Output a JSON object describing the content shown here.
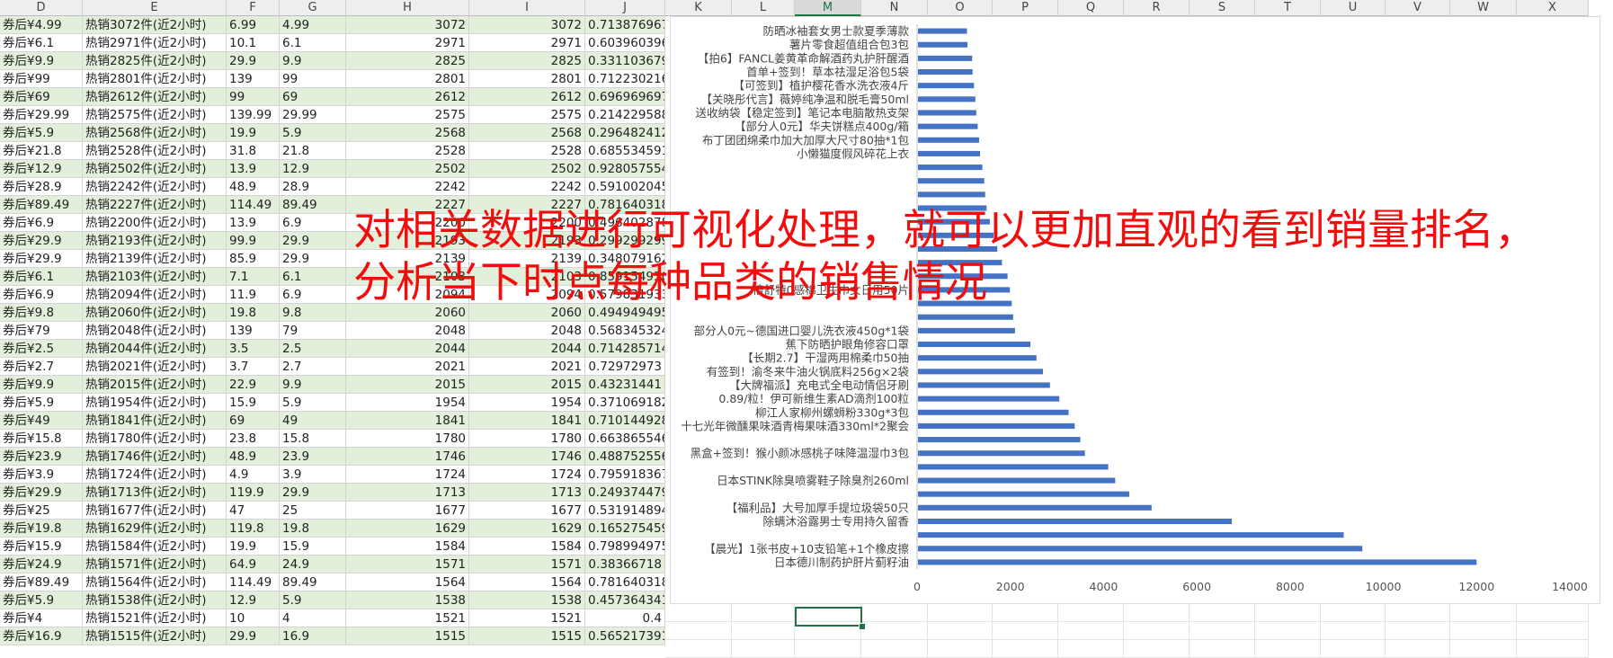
{
  "columns": [
    "D",
    "E",
    "F",
    "G",
    "H",
    "I",
    "J",
    "K",
    "L",
    "M",
    "N",
    "O",
    "P",
    "Q",
    "R",
    "S",
    "T",
    "U",
    "V",
    "W",
    "X"
  ],
  "selected_column": "M",
  "rows": [
    [
      "券后¥4.99",
      "热销3072件(近2小时)",
      "6.99",
      "4.99",
      "3072",
      "3072",
      "0.713876967"
    ],
    [
      "券后¥6.1",
      "热销2971件(近2小时)",
      "10.1",
      "6.1",
      "2971",
      "2971",
      "0.603960396"
    ],
    [
      "券后¥9.9",
      "热销2825件(近2小时)",
      "29.9",
      "9.9",
      "2825",
      "2825",
      "0.331103679"
    ],
    [
      "券后¥99",
      "热销2801件(近2小时)",
      "139",
      "99",
      "2801",
      "2801",
      "0.712230216"
    ],
    [
      "券后¥69",
      "热销2612件(近2小时)",
      "99",
      "69",
      "2612",
      "2612",
      "0.696969697"
    ],
    [
      "券后¥29.99",
      "热销2575件(近2小时)",
      "139.99",
      "29.99",
      "2575",
      "2575",
      "0.214229588"
    ],
    [
      "券后¥5.9",
      "热销2568件(近2小时)",
      "19.9",
      "5.9",
      "2568",
      "2568",
      "0.296482412"
    ],
    [
      "券后¥21.8",
      "热销2528件(近2小时)",
      "31.8",
      "21.8",
      "2528",
      "2528",
      "0.685534591"
    ],
    [
      "券后¥12.9",
      "热销2502件(近2小时)",
      "13.9",
      "12.9",
      "2502",
      "2502",
      "0.928057554"
    ],
    [
      "券后¥28.9",
      "热销2242件(近2小时)",
      "48.9",
      "28.9",
      "2242",
      "2242",
      "0.591002045"
    ],
    [
      "券后¥89.49",
      "热销2227件(近2小时)",
      "114.49",
      "89.49",
      "2227",
      "2227",
      "0.781640318"
    ],
    [
      "券后¥6.9",
      "热销2200件(近2小时)",
      "13.9",
      "6.9",
      "2200",
      "2200",
      "0.496402878"
    ],
    [
      "券后¥29.9",
      "热销2193件(近2小时)",
      "99.9",
      "29.9",
      "2193",
      "2193",
      "0.299299299"
    ],
    [
      "券后¥29.9",
      "热销2139件(近2小时)",
      "85.9",
      "29.9",
      "2139",
      "2139",
      "0.348079162"
    ],
    [
      "券后¥6.1",
      "热销2103件(近2小时)",
      "7.1",
      "6.1",
      "2103",
      "2103",
      "0.859154930"
    ],
    [
      "券后¥6.9",
      "热销2094件(近2小时)",
      "11.9",
      "6.9",
      "2094",
      "2094",
      "0.579831933"
    ],
    [
      "券后¥9.8",
      "热销2060件(近2小时)",
      "19.8",
      "9.8",
      "2060",
      "2060",
      "0.494949495"
    ],
    [
      "券后¥79",
      "热销2048件(近2小时)",
      "139",
      "79",
      "2048",
      "2048",
      "0.568345324"
    ],
    [
      "券后¥2.5",
      "热销2044件(近2小时)",
      "3.5",
      "2.5",
      "2044",
      "2044",
      "0.714285714"
    ],
    [
      "券后¥2.7",
      "热销2021件(近2小时)",
      "3.7",
      "2.7",
      "2021",
      "2021",
      "0.72972973"
    ],
    [
      "券后¥9.9",
      "热销2015件(近2小时)",
      "22.9",
      "9.9",
      "2015",
      "2015",
      "0.43231441"
    ],
    [
      "券后¥5.9",
      "热销1954件(近2小时)",
      "15.9",
      "5.9",
      "1954",
      "1954",
      "0.371069182"
    ],
    [
      "券后¥49",
      "热销1841件(近2小时)",
      "69",
      "49",
      "1841",
      "1841",
      "0.710144928"
    ],
    [
      "券后¥15.8",
      "热销1780件(近2小时)",
      "23.8",
      "15.8",
      "1780",
      "1780",
      "0.663865546"
    ],
    [
      "券后¥23.9",
      "热销1746件(近2小时)",
      "48.9",
      "23.9",
      "1746",
      "1746",
      "0.488752556"
    ],
    [
      "券后¥3.9",
      "热销1724件(近2小时)",
      "4.9",
      "3.9",
      "1724",
      "1724",
      "0.795918367"
    ],
    [
      "券后¥29.9",
      "热销1713件(近2小时)",
      "119.9",
      "29.9",
      "1713",
      "1713",
      "0.249374479"
    ],
    [
      "券后¥25",
      "热销1677件(近2小时)",
      "47",
      "25",
      "1677",
      "1677",
      "0.531914894"
    ],
    [
      "券后¥19.8",
      "热销1629件(近2小时)",
      "119.8",
      "19.8",
      "1629",
      "1629",
      "0.165275459"
    ],
    [
      "券后¥15.9",
      "热销1584件(近2小时)",
      "19.9",
      "15.9",
      "1584",
      "1584",
      "0.798994975"
    ],
    [
      "券后¥24.9",
      "热销1571件(近2小时)",
      "64.9",
      "24.9",
      "1571",
      "1571",
      "0.38366718"
    ],
    [
      "券后¥89.49",
      "热销1564件(近2小时)",
      "114.49",
      "89.49",
      "1564",
      "1564",
      "0.781640318"
    ],
    [
      "券后¥5.9",
      "热销1538件(近2小时)",
      "12.9",
      "5.9",
      "1538",
      "1538",
      "0.457364341"
    ],
    [
      "券后¥4",
      "热销1521件(近2小时)",
      "10",
      "4",
      "1521",
      "1521",
      "0.4"
    ],
    [
      "券后¥16.9",
      "热销1515件(近2小时)",
      "29.9",
      "16.9",
      "1515",
      "1515",
      "0.565217391"
    ]
  ],
  "chart_data": {
    "type": "bar",
    "orientation": "horizontal",
    "bar_color": "#4472c4",
    "grid": false,
    "xlim": [
      0,
      14000
    ],
    "xticks": [
      0,
      2000,
      4000,
      6000,
      8000,
      10000,
      12000,
      14000
    ],
    "categories": [
      "防晒冰袖套女男士款夏季薄款",
      "薯片零食超值组合包3包",
      "【拍6】FANCL姜黄革命解酒药丸护肝醒酒",
      "首单+签到！草本祛湿足浴包5袋",
      "【可签到】植护樱花香水洗衣液4斤",
      "【关晓彤代言】薇婷纯净温和脱毛膏50ml",
      "送收纳袋【稳定签到】笔记本电脑散热支架",
      "【部分人0元】华夫饼糕点400g/箱",
      "布丁团团绵柔巾加大加厚大尺寸80抽*1包",
      "小懒猫度假风碎花上衣",
      "",
      "",
      "",
      "倍舒特0感棉卫生巾女日用50片",
      "",
      "",
      "部分人0元~德国进口婴儿洗衣液450g*1袋",
      "蕉下防晒护眼角修容口罩",
      "【长期2.7】干湿两用棉柔巾50抽",
      "有签到！渝冬来牛油火锅底料256g×2袋",
      "【大牌福派】充电式全电动情侣牙刷",
      "0.89/粒！伊可新维生素AD滴剂100粒",
      "柳江人家柳州螺蛳粉330g*3包",
      "十七光年微醺果味酒青梅果味酒330ml*2聚会",
      "黑盒+签到！猴小颜冰感桃子味降温湿巾3包",
      "日本STINK除臭喷雾鞋子除臭剂260ml",
      "【福利品】大号加厚手提垃圾袋50只",
      "除螨沐浴露男士专用持久留香",
      "【晨光】1张书皮+10支铅笔+1个橡皮擦",
      "日本德川制药护肝片蓟籽油"
    ],
    "values": [
      1070,
      1080,
      1180,
      1190,
      1220,
      1250,
      1270,
      1300,
      1330,
      1350,
      1400,
      1440,
      1460,
      1490,
      1560,
      1640,
      1720,
      1820,
      1940,
      1990,
      2030,
      2060,
      2100,
      2430,
      2560,
      2700,
      2850,
      3050,
      3250,
      3380,
      3500,
      3600,
      4100,
      4250,
      4550,
      5030,
      6750,
      9150,
      9550,
      12000
    ],
    "label_rows": [
      0,
      1,
      2,
      3,
      4,
      5,
      6,
      7,
      8,
      9,
      13,
      17,
      18,
      19,
      20,
      21,
      22,
      23,
      24,
      25,
      26,
      27,
      28,
      29,
      31,
      33,
      35,
      36,
      38,
      39
    ]
  },
  "overlay": {
    "line1": "对相关数据进行可视化处理，就可以更加直观的看到销量排名，",
    "line2": "分析当下时点每种品类的销售情况"
  }
}
